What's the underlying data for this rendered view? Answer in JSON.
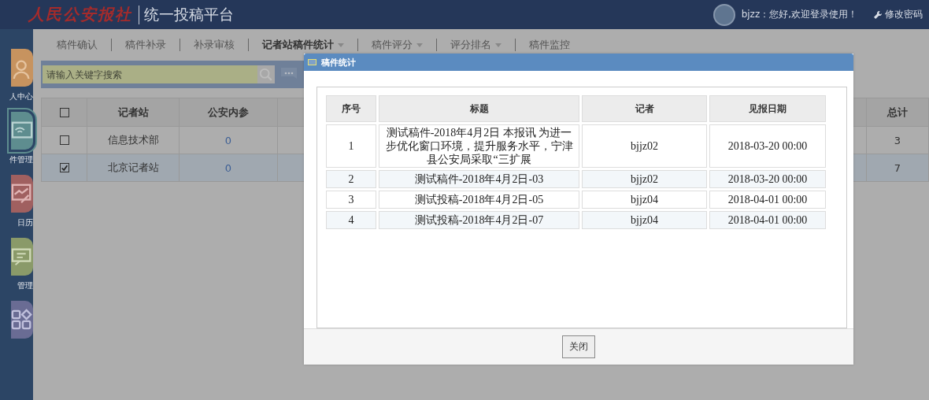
{
  "header": {
    "logo": "人民公安报社",
    "title": "统一投稿平台",
    "greeting": "bjzz：您好,欢迎登录使用！",
    "change_password": "修改密码"
  },
  "sidebar": {
    "items": [
      {
        "label": "人中心",
        "kind": "person"
      },
      {
        "label": "件管理",
        "kind": "screen"
      },
      {
        "label": "日历",
        "kind": "chart"
      },
      {
        "label": "管理",
        "kind": "board"
      },
      {
        "kind": "apps"
      }
    ]
  },
  "tabs": [
    {
      "label": "稿件确认",
      "selected": false,
      "has_menu": false
    },
    {
      "label": "稿件补录",
      "selected": false,
      "has_menu": false
    },
    {
      "label": "补录审核",
      "selected": false,
      "has_menu": false
    },
    {
      "label": "记者站稿件统计",
      "selected": true,
      "has_menu": true
    },
    {
      "label": "稿件评分",
      "selected": false,
      "has_menu": true
    },
    {
      "label": "评分排名",
      "selected": false,
      "has_menu": true
    },
    {
      "label": "稿件监控",
      "selected": false,
      "has_menu": false
    }
  ],
  "search": {
    "placeholder": "请输入关键字搜索"
  },
  "table": {
    "all_checked": false,
    "columns": [
      "记者站",
      "公安内参",
      "总计"
    ],
    "rows": [
      {
        "checked": false,
        "selected": false,
        "cells": [
          "信息技术部",
          "0",
          "3"
        ]
      },
      {
        "checked": true,
        "selected": true,
        "cells": [
          "北京记者站",
          "0",
          "7"
        ]
      }
    ]
  },
  "dialog": {
    "title": "稿件统计",
    "columns": [
      "序号",
      "标题",
      "记者",
      "见报日期"
    ],
    "rows": [
      [
        "1",
        "测试稿件-2018年4月2日 本报讯 为进一步优化窗口环境，提升服务水平，宁津县公安局采取“三扩展",
        "bjjz02",
        "2018-03-20 00:00"
      ],
      [
        "2",
        "测试稿件-2018年4月2日-03",
        "bjjz02",
        "2018-03-20 00:00"
      ],
      [
        "3",
        "测试投稿-2018年4月2日-05",
        "bjjz04",
        "2018-04-01 00:00"
      ],
      [
        "4",
        "测试投稿-2018年4月2日-07",
        "bjjz04",
        "2018-04-01 00:00"
      ]
    ],
    "close_button": "关闭"
  }
}
